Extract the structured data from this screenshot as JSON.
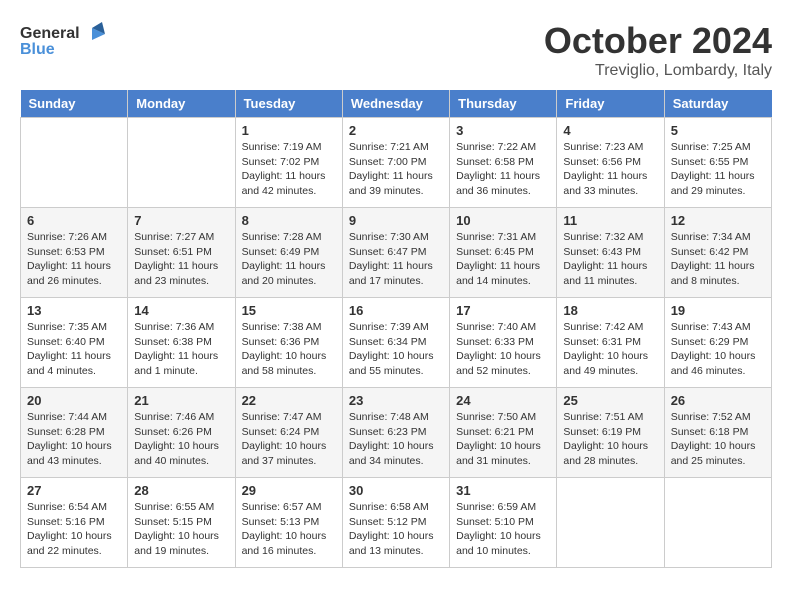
{
  "header": {
    "logo_general": "General",
    "logo_blue": "Blue",
    "month_title": "October 2024",
    "location": "Treviglio, Lombardy, Italy"
  },
  "days_of_week": [
    "Sunday",
    "Monday",
    "Tuesday",
    "Wednesday",
    "Thursday",
    "Friday",
    "Saturday"
  ],
  "weeks": [
    [
      {
        "day": "",
        "sunrise": "",
        "sunset": "",
        "daylight": ""
      },
      {
        "day": "",
        "sunrise": "",
        "sunset": "",
        "daylight": ""
      },
      {
        "day": "1",
        "sunrise": "Sunrise: 7:19 AM",
        "sunset": "Sunset: 7:02 PM",
        "daylight": "Daylight: 11 hours and 42 minutes."
      },
      {
        "day": "2",
        "sunrise": "Sunrise: 7:21 AM",
        "sunset": "Sunset: 7:00 PM",
        "daylight": "Daylight: 11 hours and 39 minutes."
      },
      {
        "day": "3",
        "sunrise": "Sunrise: 7:22 AM",
        "sunset": "Sunset: 6:58 PM",
        "daylight": "Daylight: 11 hours and 36 minutes."
      },
      {
        "day": "4",
        "sunrise": "Sunrise: 7:23 AM",
        "sunset": "Sunset: 6:56 PM",
        "daylight": "Daylight: 11 hours and 33 minutes."
      },
      {
        "day": "5",
        "sunrise": "Sunrise: 7:25 AM",
        "sunset": "Sunset: 6:55 PM",
        "daylight": "Daylight: 11 hours and 29 minutes."
      }
    ],
    [
      {
        "day": "6",
        "sunrise": "Sunrise: 7:26 AM",
        "sunset": "Sunset: 6:53 PM",
        "daylight": "Daylight: 11 hours and 26 minutes."
      },
      {
        "day": "7",
        "sunrise": "Sunrise: 7:27 AM",
        "sunset": "Sunset: 6:51 PM",
        "daylight": "Daylight: 11 hours and 23 minutes."
      },
      {
        "day": "8",
        "sunrise": "Sunrise: 7:28 AM",
        "sunset": "Sunset: 6:49 PM",
        "daylight": "Daylight: 11 hours and 20 minutes."
      },
      {
        "day": "9",
        "sunrise": "Sunrise: 7:30 AM",
        "sunset": "Sunset: 6:47 PM",
        "daylight": "Daylight: 11 hours and 17 minutes."
      },
      {
        "day": "10",
        "sunrise": "Sunrise: 7:31 AM",
        "sunset": "Sunset: 6:45 PM",
        "daylight": "Daylight: 11 hours and 14 minutes."
      },
      {
        "day": "11",
        "sunrise": "Sunrise: 7:32 AM",
        "sunset": "Sunset: 6:43 PM",
        "daylight": "Daylight: 11 hours and 11 minutes."
      },
      {
        "day": "12",
        "sunrise": "Sunrise: 7:34 AM",
        "sunset": "Sunset: 6:42 PM",
        "daylight": "Daylight: 11 hours and 8 minutes."
      }
    ],
    [
      {
        "day": "13",
        "sunrise": "Sunrise: 7:35 AM",
        "sunset": "Sunset: 6:40 PM",
        "daylight": "Daylight: 11 hours and 4 minutes."
      },
      {
        "day": "14",
        "sunrise": "Sunrise: 7:36 AM",
        "sunset": "Sunset: 6:38 PM",
        "daylight": "Daylight: 11 hours and 1 minute."
      },
      {
        "day": "15",
        "sunrise": "Sunrise: 7:38 AM",
        "sunset": "Sunset: 6:36 PM",
        "daylight": "Daylight: 10 hours and 58 minutes."
      },
      {
        "day": "16",
        "sunrise": "Sunrise: 7:39 AM",
        "sunset": "Sunset: 6:34 PM",
        "daylight": "Daylight: 10 hours and 55 minutes."
      },
      {
        "day": "17",
        "sunrise": "Sunrise: 7:40 AM",
        "sunset": "Sunset: 6:33 PM",
        "daylight": "Daylight: 10 hours and 52 minutes."
      },
      {
        "day": "18",
        "sunrise": "Sunrise: 7:42 AM",
        "sunset": "Sunset: 6:31 PM",
        "daylight": "Daylight: 10 hours and 49 minutes."
      },
      {
        "day": "19",
        "sunrise": "Sunrise: 7:43 AM",
        "sunset": "Sunset: 6:29 PM",
        "daylight": "Daylight: 10 hours and 46 minutes."
      }
    ],
    [
      {
        "day": "20",
        "sunrise": "Sunrise: 7:44 AM",
        "sunset": "Sunset: 6:28 PM",
        "daylight": "Daylight: 10 hours and 43 minutes."
      },
      {
        "day": "21",
        "sunrise": "Sunrise: 7:46 AM",
        "sunset": "Sunset: 6:26 PM",
        "daylight": "Daylight: 10 hours and 40 minutes."
      },
      {
        "day": "22",
        "sunrise": "Sunrise: 7:47 AM",
        "sunset": "Sunset: 6:24 PM",
        "daylight": "Daylight: 10 hours and 37 minutes."
      },
      {
        "day": "23",
        "sunrise": "Sunrise: 7:48 AM",
        "sunset": "Sunset: 6:23 PM",
        "daylight": "Daylight: 10 hours and 34 minutes."
      },
      {
        "day": "24",
        "sunrise": "Sunrise: 7:50 AM",
        "sunset": "Sunset: 6:21 PM",
        "daylight": "Daylight: 10 hours and 31 minutes."
      },
      {
        "day": "25",
        "sunrise": "Sunrise: 7:51 AM",
        "sunset": "Sunset: 6:19 PM",
        "daylight": "Daylight: 10 hours and 28 minutes."
      },
      {
        "day": "26",
        "sunrise": "Sunrise: 7:52 AM",
        "sunset": "Sunset: 6:18 PM",
        "daylight": "Daylight: 10 hours and 25 minutes."
      }
    ],
    [
      {
        "day": "27",
        "sunrise": "Sunrise: 6:54 AM",
        "sunset": "Sunset: 5:16 PM",
        "daylight": "Daylight: 10 hours and 22 minutes."
      },
      {
        "day": "28",
        "sunrise": "Sunrise: 6:55 AM",
        "sunset": "Sunset: 5:15 PM",
        "daylight": "Daylight: 10 hours and 19 minutes."
      },
      {
        "day": "29",
        "sunrise": "Sunrise: 6:57 AM",
        "sunset": "Sunset: 5:13 PM",
        "daylight": "Daylight: 10 hours and 16 minutes."
      },
      {
        "day": "30",
        "sunrise": "Sunrise: 6:58 AM",
        "sunset": "Sunset: 5:12 PM",
        "daylight": "Daylight: 10 hours and 13 minutes."
      },
      {
        "day": "31",
        "sunrise": "Sunrise: 6:59 AM",
        "sunset": "Sunset: 5:10 PM",
        "daylight": "Daylight: 10 hours and 10 minutes."
      },
      {
        "day": "",
        "sunrise": "",
        "sunset": "",
        "daylight": ""
      },
      {
        "day": "",
        "sunrise": "",
        "sunset": "",
        "daylight": ""
      }
    ]
  ]
}
